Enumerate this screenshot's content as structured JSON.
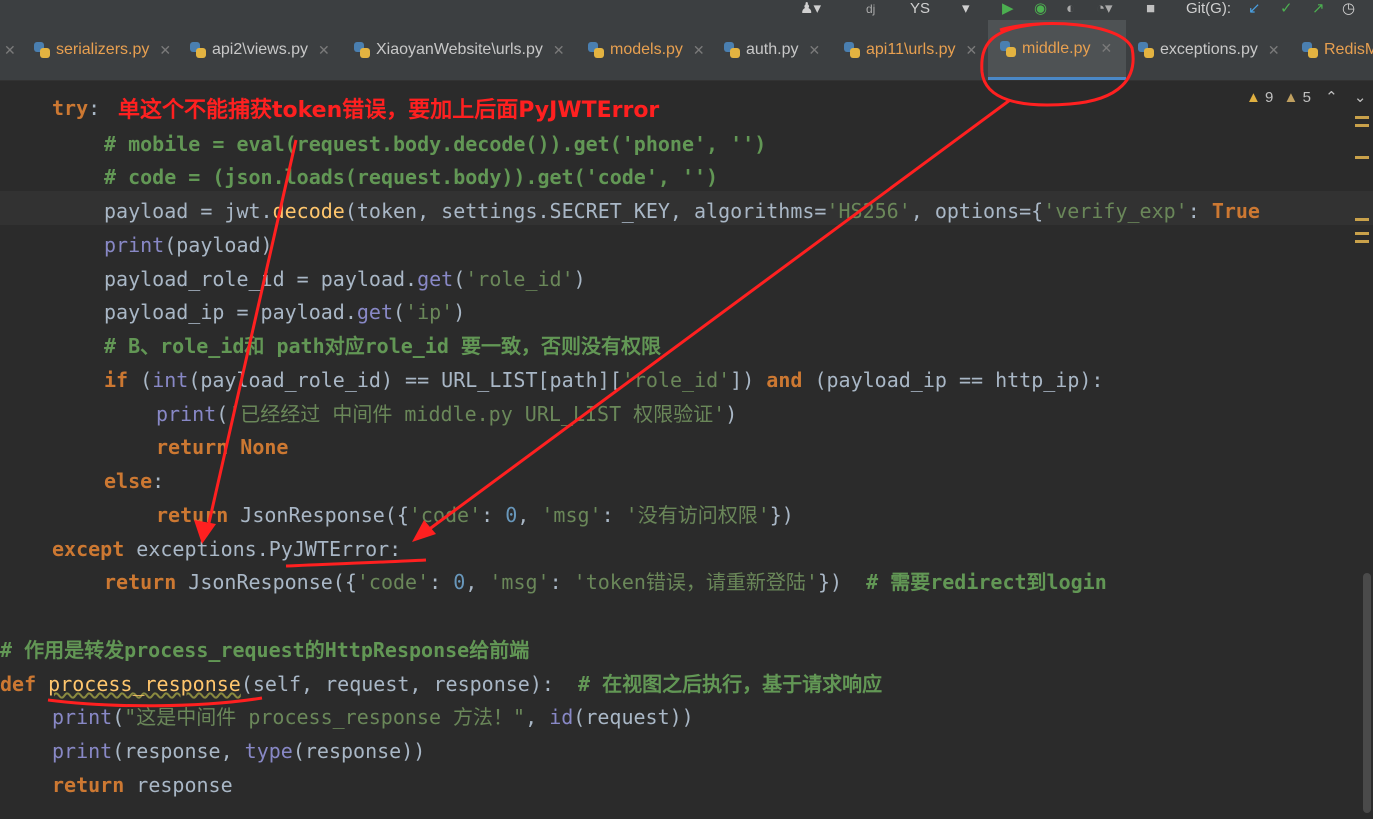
{
  "toolbar": {
    "user_label": "YS",
    "git_label": "Git(G):",
    "icons": [
      "user-icon",
      "django-icon",
      "dropdown-icon",
      "run-icon",
      "debug-icon",
      "coverage-icon",
      "profile-icon",
      "stop-icon",
      "git-update-icon",
      "git-commit-icon",
      "git-push-icon",
      "history-icon"
    ]
  },
  "tabs": [
    {
      "label": "serializers.py",
      "active": false
    },
    {
      "label": "api2\\views.py",
      "active": false
    },
    {
      "label": "XiaoyanWebsite\\urls.py",
      "active": false
    },
    {
      "label": "models.py",
      "active": false
    },
    {
      "label": "auth.py",
      "active": false
    },
    {
      "label": "api11\\urls.py",
      "active": false
    },
    {
      "label": "middle.py",
      "active": true
    },
    {
      "label": "exceptions.py",
      "active": false
    },
    {
      "label": "RedisM",
      "active": false
    }
  ],
  "inspections": {
    "warnings": "9",
    "weak_warnings": "5"
  },
  "annotation": "单这个不能捕获token错误，要加上后面PyJWTError",
  "code": {
    "l1_try": "try",
    "l1_colon": ":",
    "l2": "# mobile = eval(request.body.decode()).get('phone', '')",
    "l3": "# code = (json.loads(request.body)).get('code', '')",
    "l4_a": "payload = jwt.",
    "l4_fn": "decode",
    "l4_b": "(token, settings.SECRET_KEY, algorithms=",
    "l4_s1": "'HS256'",
    "l4_c": ", options={",
    "l4_s2": "'verify_exp'",
    "l4_d": ": ",
    "l4_true": "True",
    "l5_fn": "print",
    "l5_b": "(payload)",
    "l6_a": "payload_role_id = payload.",
    "l6_fn": "get",
    "l6_b": "(",
    "l6_s": "'role_id'",
    "l6_c": ")",
    "l7_a": "payload_ip = payload.",
    "l7_fn": "get",
    "l7_b": "(",
    "l7_s": "'ip'",
    "l7_c": ")",
    "l8": "# B、role_id和 path对应role_id 要一致，否则没有权限",
    "l9_if": "if",
    "l9_b": " (",
    "l9_int": "int",
    "l9_c": "(payload_role_id) == URL_LIST[path][",
    "l9_s": "'role_id'",
    "l9_d": "]) ",
    "l9_and": "and",
    "l9_e": " (payload_ip == http_ip):",
    "l10_fn": "print",
    "l10_b": "(",
    "l10_s": "'已经经过 中间件 middle.py URL_LIST 权限验证'",
    "l10_c": ")",
    "l11_ret": "return",
    "l11_none": "None",
    "l12_else": "else",
    "l12_colon": ":",
    "l13_ret": "return",
    "l13_a": " JsonResponse({",
    "l13_s1": "'code'",
    "l13_b": ": ",
    "l13_n": "0",
    "l13_c": ", ",
    "l13_s2": "'msg'",
    "l13_d": ": ",
    "l13_s3": "'没有访问权限'",
    "l13_e": "})",
    "l14_except": "except",
    "l14_a": " exceptions.PyJWTError:",
    "l15_ret": "return",
    "l15_a": " JsonResponse({",
    "l15_s1": "'code'",
    "l15_b": ": ",
    "l15_n": "0",
    "l15_c": ", ",
    "l15_s2": "'msg'",
    "l15_d": ": ",
    "l15_s3": "'token错误，请重新登陆'",
    "l15_e": "})  ",
    "l15_cm": "# 需要redirect到login",
    "l17": "# 作用是转发process_request的HttpResponse给前端",
    "l18_def": "def",
    "l18_fn": "process_response",
    "l18_a": "(self, request, response):  ",
    "l18_cm": "# 在视图之后执行，基于请求响应",
    "l19_fn": "print",
    "l19_a": "(",
    "l19_s": "\"这是中间件 process_response 方法！\"",
    "l19_b": ", ",
    "l19_id": "id",
    "l19_c": "(request))",
    "l20_fn": "print",
    "l20_a": "(response, ",
    "l20_type": "type",
    "l20_b": "(response))",
    "l21_ret": "return",
    "l21_a": " response"
  },
  "colors": {
    "keyword": "#cc7832",
    "string": "#6a8759",
    "comment": "#629755",
    "builtin": "#8888c6",
    "annotation": "#ff2020",
    "background": "#2b2b2b"
  }
}
